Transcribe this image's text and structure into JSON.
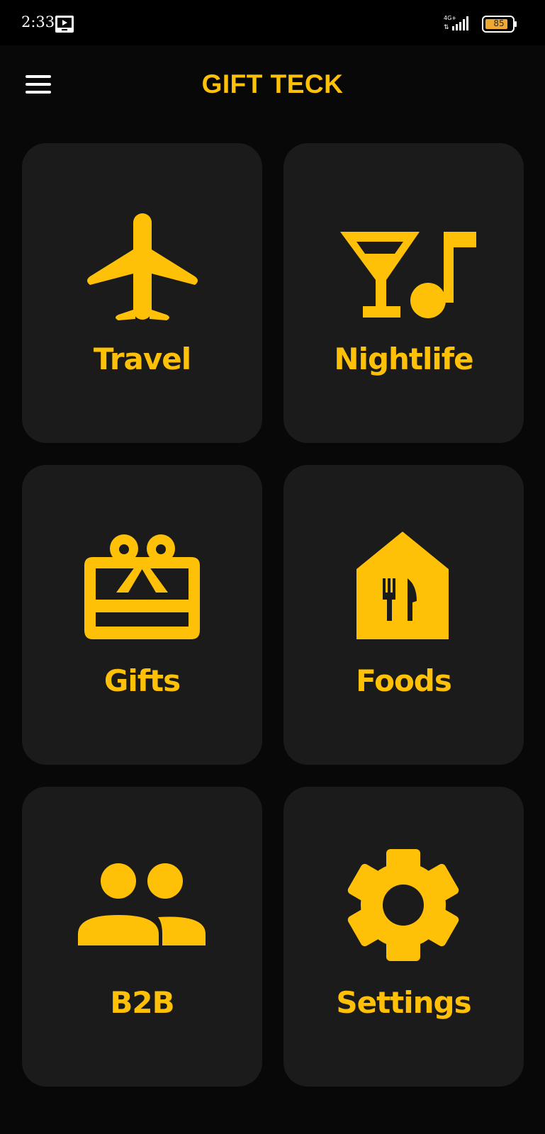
{
  "status_bar": {
    "time": "2:33",
    "network": "4G+",
    "battery": "85"
  },
  "app_bar": {
    "title": "GIFT TECK",
    "menu_icon": "hamburger-menu-icon"
  },
  "tiles": [
    {
      "label": "Travel",
      "icon": "airplane-icon"
    },
    {
      "label": "Nightlife",
      "icon": "cocktail-music-icon"
    },
    {
      "label": "Gifts",
      "icon": "gift-card-icon"
    },
    {
      "label": "Foods",
      "icon": "restaurant-icon"
    },
    {
      "label": "B2B",
      "icon": "people-icon"
    },
    {
      "label": "Settings",
      "icon": "gear-icon"
    }
  ],
  "colors": {
    "accent": "#FFC107",
    "background": "#080808",
    "tile": "#1b1b1b"
  }
}
